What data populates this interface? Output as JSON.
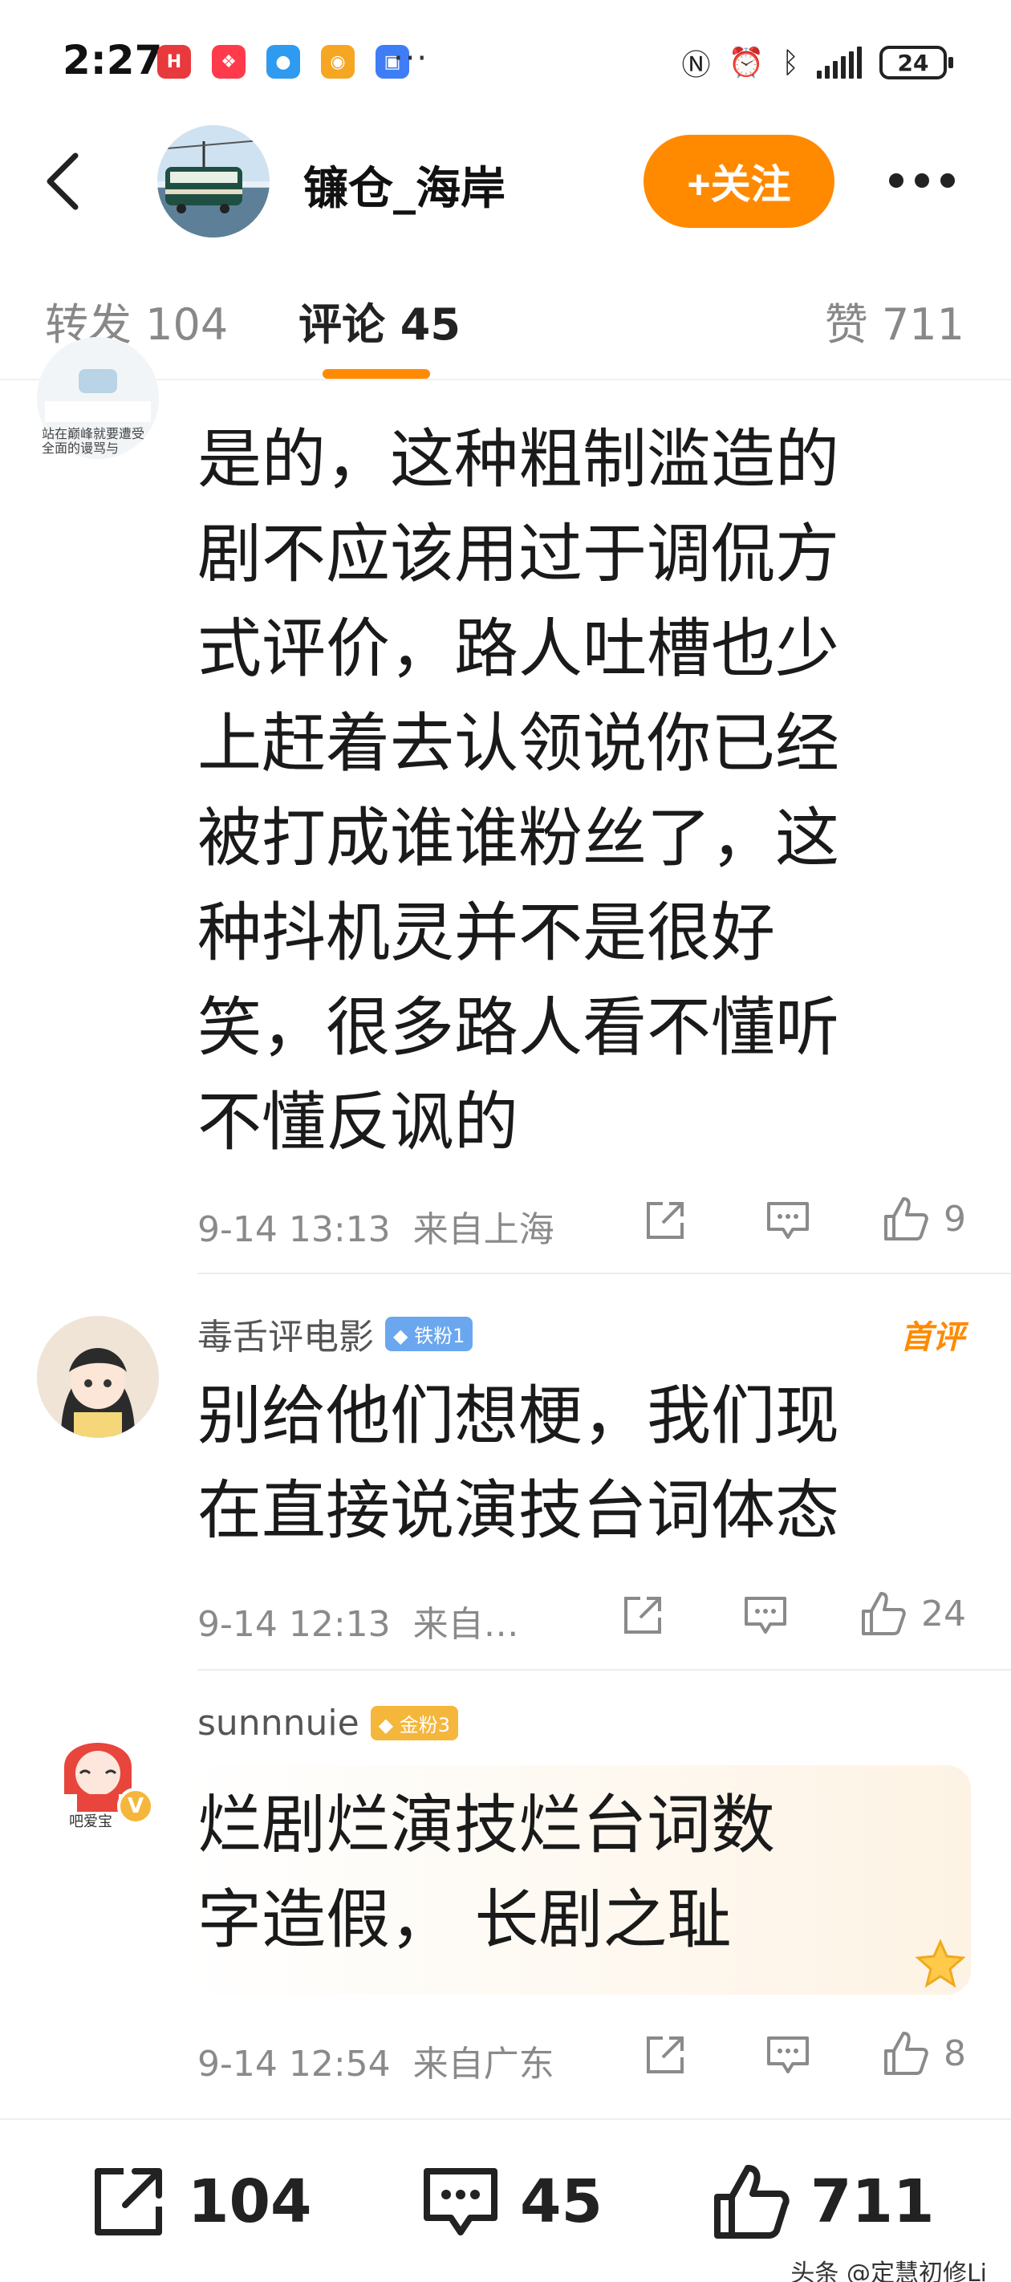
{
  "status_bar": {
    "time": "2:27",
    "dots": "···",
    "battery": "24",
    "apps": [
      {
        "icon": "huawei-mall-icon",
        "color": "#e8393d",
        "glyph": "H"
      },
      {
        "icon": "red-app-icon",
        "color": "#ff3b4b",
        "glyph": "❖"
      },
      {
        "icon": "blue-chat-icon",
        "color": "#2e9bf0",
        "glyph": "●"
      },
      {
        "icon": "weibo-icon",
        "color": "#f5a623",
        "glyph": "◉"
      },
      {
        "icon": "blue-app-icon",
        "color": "#3e7df5",
        "glyph": "▣"
      }
    ]
  },
  "header": {
    "user_name": "镰仓_海岸",
    "follow_label": "+关注"
  },
  "tabs": {
    "repost": "转发 104",
    "comment": "评论 45",
    "like": "赞 711"
  },
  "comments": [
    {
      "avatar_caption": "站在巅峰就要遭受全面的谩骂与",
      "text_lines": [
        "是的，这种粗制滥造的",
        "剧不应该用过于调侃方",
        "式评价，路人吐槽也少",
        "上赶着去认领说你已经",
        "被打成谁谁粉丝了，这",
        "种抖机灵并不是很好",
        "笑，很多路人看不懂听",
        "不懂反讽的"
      ],
      "time": "9-14 13:13",
      "location": "来自上海",
      "likes": "9"
    },
    {
      "name": "毒舌评电影",
      "badge": "铁粉1",
      "tag": "首评",
      "text_lines": [
        "别给他们想梗，我们现",
        "在直接说演技台词体态"
      ],
      "time": "9-14 12:13",
      "location": "来自…",
      "likes": "24"
    },
    {
      "name": "sunnnuie",
      "badge": "金粉3",
      "avatar_caption": "吧爱宝",
      "text_lines": [
        "烂剧烂演技烂台词数",
        "字造假， 长剧之耻"
      ],
      "time": "9-14 12:54",
      "location": "来自广东",
      "likes": "8"
    }
  ],
  "bottom_bar": {
    "repost_count": "104",
    "comment_count": "45",
    "like_count": "711"
  },
  "watermark": "头条 @定慧初修Li",
  "colors": {
    "accent": "#ff8a00",
    "iron_badge": "#6aa7ee",
    "gold_badge": "#f5b63c"
  }
}
